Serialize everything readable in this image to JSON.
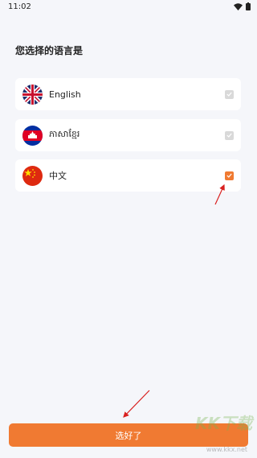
{
  "status_bar": {
    "time": "11:02"
  },
  "title": "您选择的语言是",
  "languages": [
    {
      "label": "English",
      "selected": false
    },
    {
      "label": "ភាសាខ្មែរ",
      "selected": false
    },
    {
      "label": "中文",
      "selected": true
    }
  ],
  "confirm_button": {
    "label": "选好了"
  },
  "watermark": {
    "text": "KK下载",
    "url": "www.kkx.net"
  },
  "colors": {
    "accent": "#f07a32",
    "annotation": "#d9201f"
  }
}
